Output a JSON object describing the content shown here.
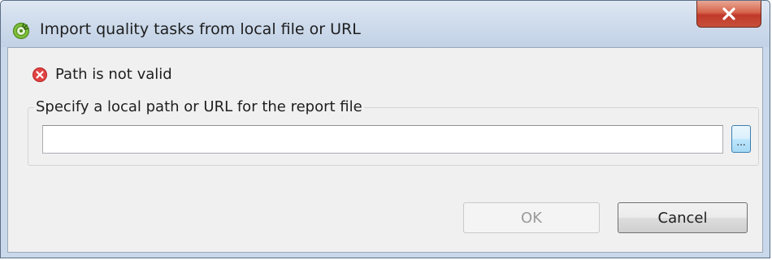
{
  "window": {
    "title": "Import quality tasks from local file or URL",
    "close_label": "X"
  },
  "status": {
    "message": "Path is not valid",
    "icon": "error-icon",
    "color": "#e04343"
  },
  "path_group": {
    "label": "Specify a local path or URL for the report file",
    "input_value": "",
    "browse_label": "..."
  },
  "buttons": {
    "ok_label": "OK",
    "cancel_label": "Cancel"
  }
}
